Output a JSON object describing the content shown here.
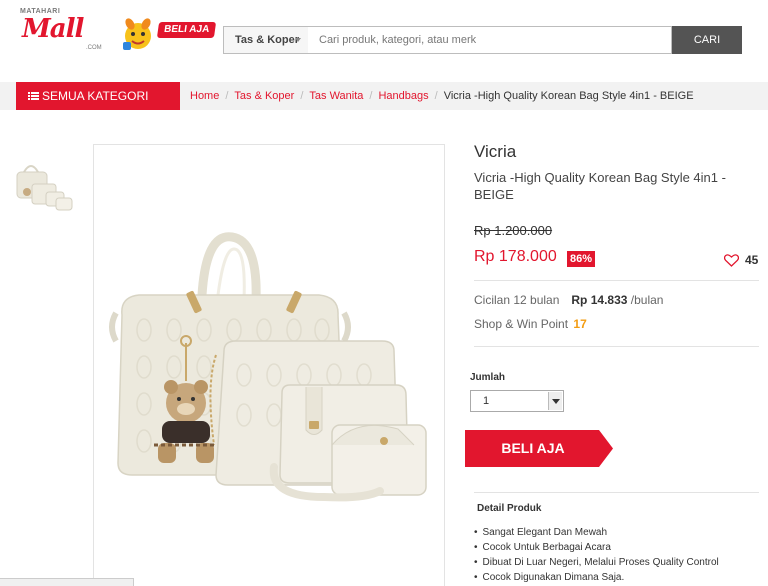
{
  "header": {
    "logo_top": "MATAHARI",
    "logo_main": "Mall",
    "logo_com": ".COM",
    "promo_badge": "BELI AJA",
    "search": {
      "category": "Tas & Koper",
      "placeholder": "Cari produk, kategori, atau merk",
      "button": "CARI"
    }
  },
  "nav": {
    "all_categories": "SEMUA KATEGORI",
    "breadcrumb": [
      "Home",
      "Tas & Koper",
      "Tas Wanita",
      "Handbags"
    ],
    "breadcrumb_current": "Vicria -High Quality Korean Bag Style 4in1 - BEIGE"
  },
  "product": {
    "brand": "Vicria",
    "title": "Vicria -High Quality Korean Bag Style 4in1 - BEIGE",
    "old_price": "Rp 1.200.000",
    "price": "Rp 178.000",
    "discount": "86%",
    "likes": "45",
    "installment_label": "Cicilan 12 bulan",
    "installment_amount": "Rp 14.833",
    "installment_unit": "/bulan",
    "point_label": "Shop & Win Point",
    "point_value": "17",
    "quantity_label": "Jumlah",
    "quantity_value": "1",
    "buy_button": "BELI AJA",
    "detail_heading": "Detail Produk",
    "features": [
      "Sangat Elegant Dan Mewah",
      "Cocok Untuk Berbagai Acara",
      "Dibuat Di Luar Negeri, Melalui Proses Quality Control",
      "Cocok Digunakan Dimana Saja."
    ]
  },
  "colors": {
    "brand_red": "#e2162e",
    "search_button": "#545454",
    "nav_background": "#f2f2f2",
    "point_orange": "#f39c12",
    "bag_beige": "#ece9dd"
  },
  "icons": [
    "menu-icon",
    "heart-icon",
    "dropdown-caret-icon",
    "mascot-icon"
  ]
}
